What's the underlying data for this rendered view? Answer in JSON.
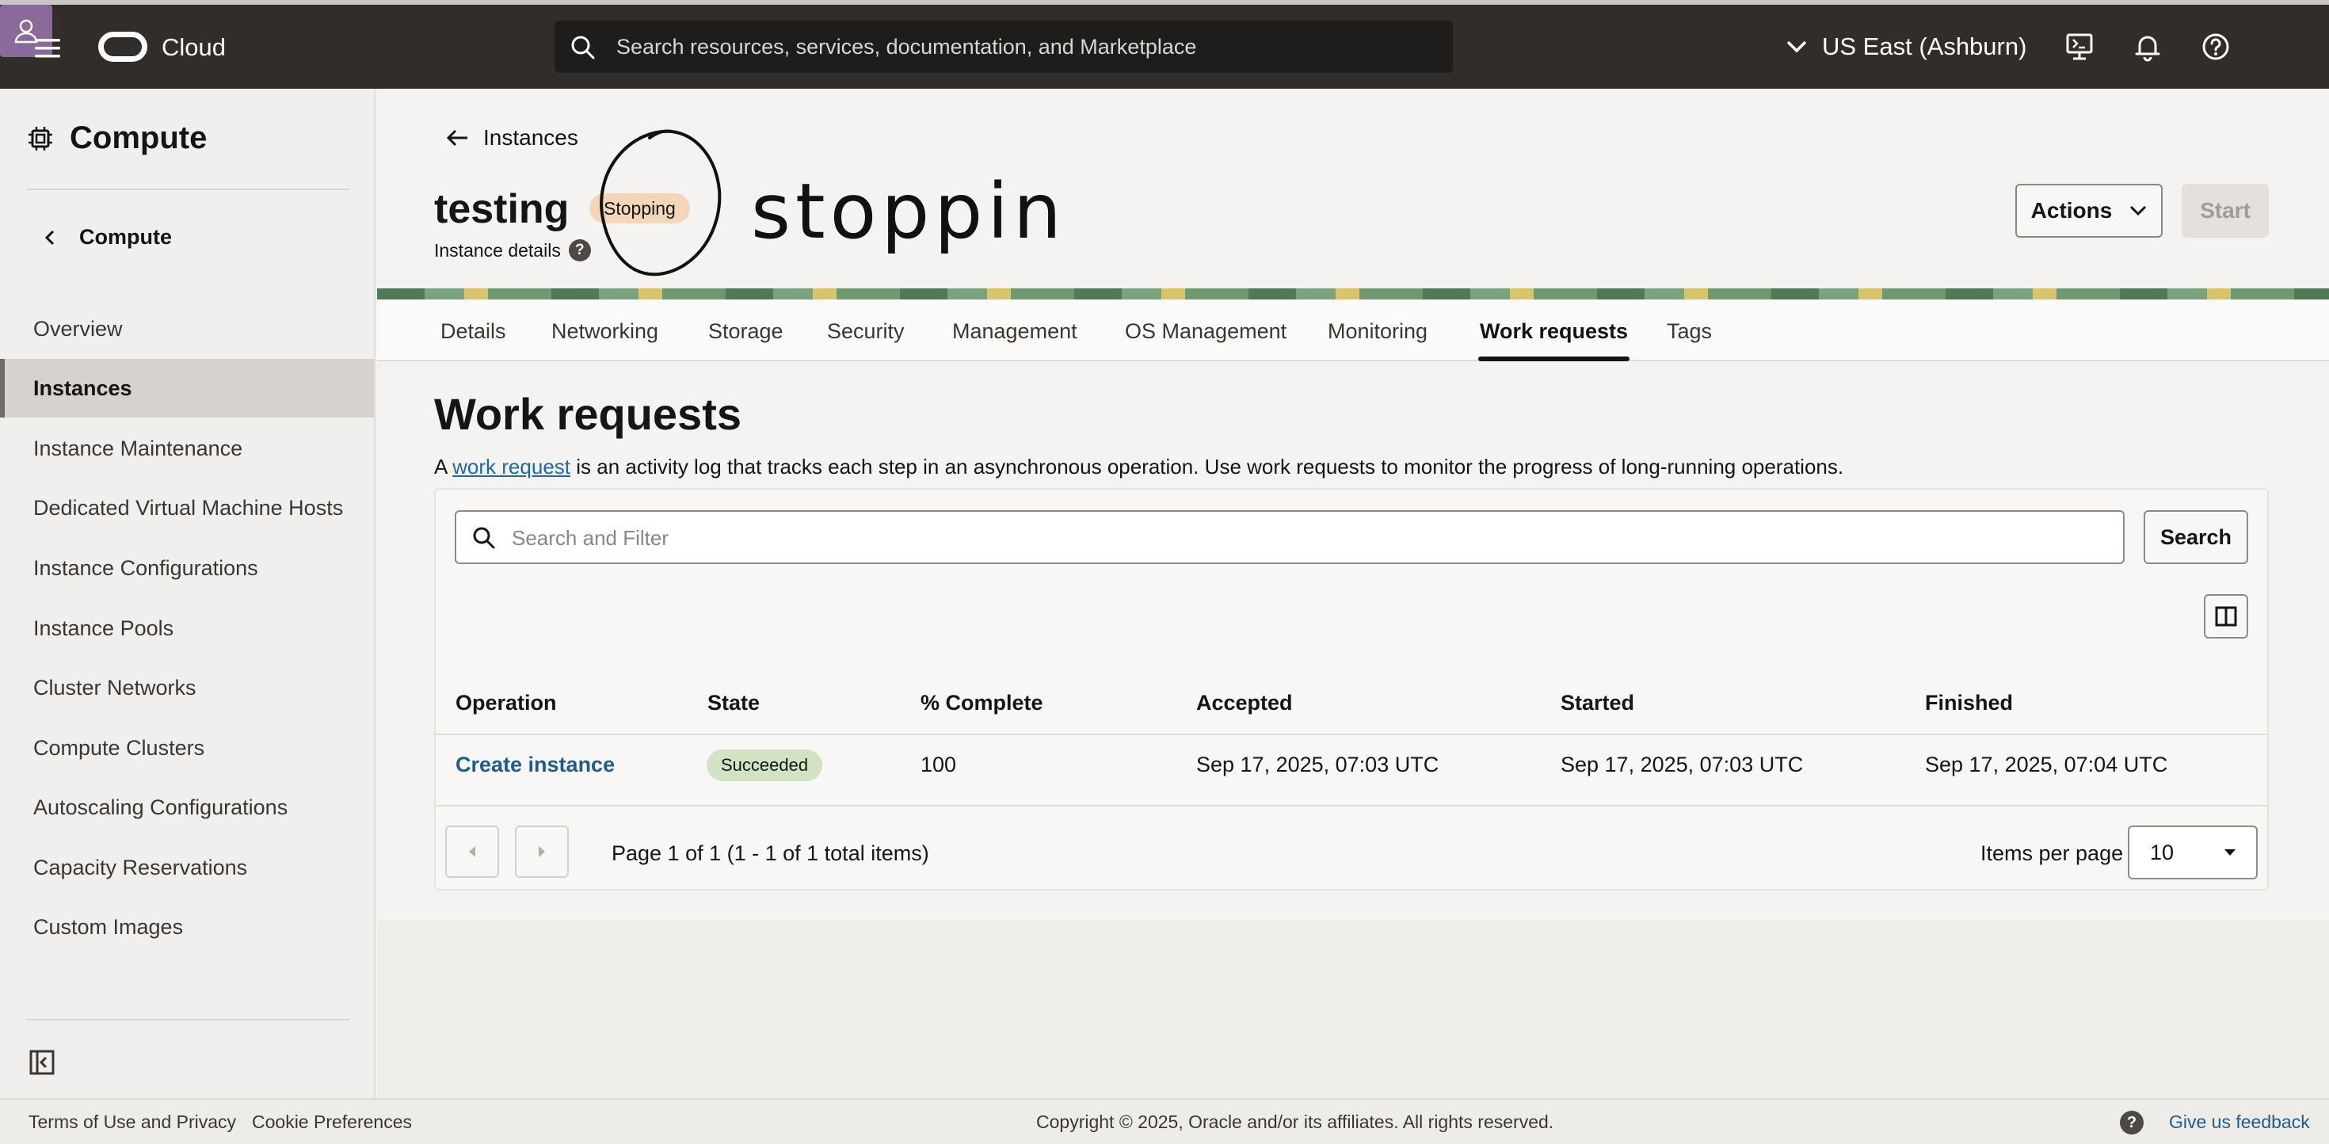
{
  "topbar": {
    "brand": "Cloud",
    "search_placeholder": "Search resources, services, documentation, and Marketplace",
    "region": "US East (Ashburn)"
  },
  "sidebar": {
    "title": "Compute",
    "back_label": "Compute",
    "items": [
      {
        "label": "Overview"
      },
      {
        "label": "Instances",
        "active": true
      },
      {
        "label": "Instance Maintenance"
      },
      {
        "label": "Dedicated Virtual Machine Hosts"
      },
      {
        "label": "Instance Configurations"
      },
      {
        "label": "Instance Pools"
      },
      {
        "label": "Cluster Networks"
      },
      {
        "label": "Compute Clusters"
      },
      {
        "label": "Autoscaling Configurations"
      },
      {
        "label": "Capacity Reservations"
      },
      {
        "label": "Custom Images"
      }
    ]
  },
  "header": {
    "back_link": "Instances",
    "instance_name": "testing",
    "state": "Stopping",
    "subtitle": "Instance details",
    "help": "?",
    "handwritten_note": "stopping",
    "actions_label": "Actions",
    "start_label": "Start"
  },
  "tabs": [
    {
      "label": "Details"
    },
    {
      "label": "Networking"
    },
    {
      "label": "Storage"
    },
    {
      "label": "Security"
    },
    {
      "label": "Management"
    },
    {
      "label": "OS Management"
    },
    {
      "label": "Monitoring"
    },
    {
      "label": "Work requests",
      "active": true
    },
    {
      "label": "Tags"
    }
  ],
  "work_requests": {
    "title": "Work requests",
    "desc_prefix": "A",
    "desc_link": "work request",
    "desc_suffix": "is an activity log that tracks each step in an asynchronous operation. Use work requests to monitor the progress of long-running operations.",
    "filter_placeholder": "Search and Filter",
    "search_button": "Search",
    "columns": [
      "Operation",
      "State",
      "% Complete",
      "Accepted",
      "Started",
      "Finished"
    ],
    "rows": [
      {
        "operation": "Create instance",
        "state": "Succeeded",
        "percent": "100",
        "accepted": "Sep 17, 2025, 07:03 UTC",
        "started": "Sep 17, 2025, 07:03 UTC",
        "finished": "Sep 17, 2025, 07:04 UTC"
      }
    ],
    "page_info": "Page 1 of 1 (1 - 1 of 1 total items)",
    "items_per_page_label": "Items per page",
    "items_per_page_value": "10"
  },
  "footer": {
    "terms": "Terms of Use and Privacy",
    "cookies": "Cookie Preferences",
    "copyright": "Copyright © 2025, Oracle and/or its affiliates. All rights reserved.",
    "help": "?",
    "feedback": "Give us feedback"
  },
  "colors": {
    "topbar": "#312d2a",
    "link": "#1e5c8e",
    "stopping_badge": "#f4d6b8",
    "succeeded_badge": "#d2e3c3"
  }
}
